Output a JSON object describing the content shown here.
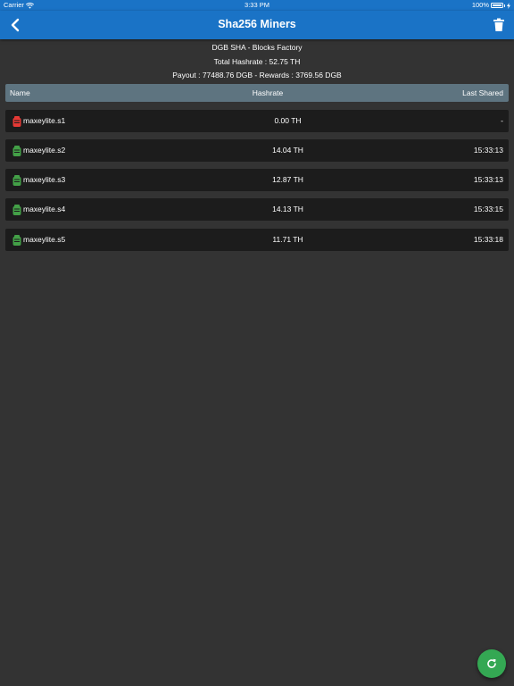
{
  "status_bar": {
    "carrier": "Carrier",
    "time": "3:33 PM",
    "battery": "100%"
  },
  "nav": {
    "title": "Sha256 Miners",
    "back_icon": "chevron-left-icon",
    "delete_icon": "trash-icon"
  },
  "info": {
    "pool": "DGB SHA - Blocks Factory",
    "total_hashrate": "Total Hashrate : 52.75 TH",
    "payout": "Payout : 77488.76 DGB - Rewards : 3769.56 DGB"
  },
  "table": {
    "headers": {
      "name": "Name",
      "hashrate": "Hashrate",
      "last_shared": "Last Shared"
    },
    "rows": [
      {
        "name": "maxeylite.s1",
        "hashrate": "0.00 TH",
        "last_shared": "-",
        "status": "offline",
        "status_color": "#e53935"
      },
      {
        "name": "maxeylite.s2",
        "hashrate": "14.04 TH",
        "last_shared": "15:33:13",
        "status": "online",
        "status_color": "#43a047"
      },
      {
        "name": "maxeylite.s3",
        "hashrate": "12.87 TH",
        "last_shared": "15:33:13",
        "status": "online",
        "status_color": "#43a047"
      },
      {
        "name": "maxeylite.s4",
        "hashrate": "14.13 TH",
        "last_shared": "15:33:15",
        "status": "online",
        "status_color": "#43a047"
      },
      {
        "name": "maxeylite.s5",
        "hashrate": "11.71 TH",
        "last_shared": "15:33:18",
        "status": "online",
        "status_color": "#43a047"
      }
    ]
  },
  "fab": {
    "icon": "refresh-icon",
    "color": "#34a853"
  },
  "colors": {
    "accent": "#1a73c6",
    "background": "#333333",
    "row_background": "#1c1c1c",
    "header_background": "#5e7480"
  }
}
